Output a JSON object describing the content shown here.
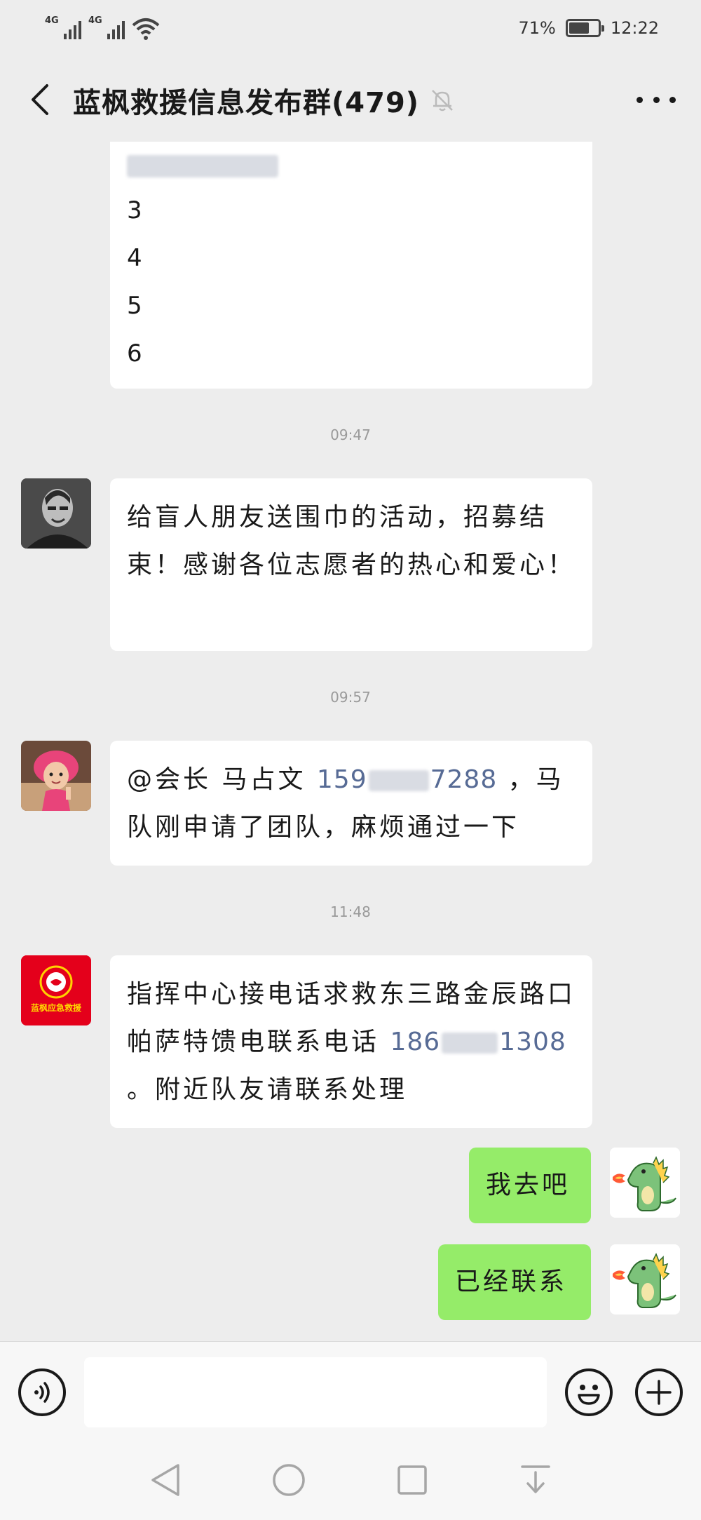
{
  "status_bar": {
    "network_1": "4G",
    "network_2": "4G",
    "battery": "71%",
    "battery_level": 0.71,
    "time": "12:22"
  },
  "header": {
    "title": "蓝枫救援信息发布群(479)",
    "icons": {
      "back": "back-chevron-icon",
      "mute": "bell-muted-icon",
      "more": "more-dots-icon"
    }
  },
  "messages": {
    "list_fragment": {
      "items": [
        "3",
        "4",
        "5",
        "6"
      ]
    },
    "time_1": "09:47",
    "msg_1": {
      "text": "给盲人朋友送围巾的活动，招募结束！感谢各位志愿者的热心和爱心！"
    },
    "time_2": "09:57",
    "msg_2": {
      "mention": "@会长 马占文 ",
      "phone_a": "159",
      "phone_b": "7288",
      "text": " ，马队刚申请了团队，麻烦通过一下"
    },
    "time_3": "11:48",
    "msg_3": {
      "org_avatar_text": "蓝枫应急救援",
      "text": "指挥中心接电话求救东三路金辰路口帕萨特馈电联系电话 ",
      "phone_a": "186",
      "phone_b": "1308",
      "text_end": " 。附近队友请联系处理"
    },
    "msg_4": {
      "text": "我去吧"
    },
    "msg_5": {
      "text": "已经联系"
    }
  },
  "input_bar": {
    "placeholder": "",
    "icons": {
      "voice": "voice-icon",
      "emoji": "emoji-icon",
      "plus": "plus-icon"
    }
  },
  "nav_bar": {
    "icons": [
      "back-triangle-icon",
      "home-circle-icon",
      "recents-square-icon",
      "notification-pull-icon"
    ]
  },
  "colors": {
    "background": "#ededed",
    "bubble_self": "#95ec69",
    "bubble_other": "#ffffff",
    "link": "#576b95",
    "org_red": "#e4001b"
  }
}
